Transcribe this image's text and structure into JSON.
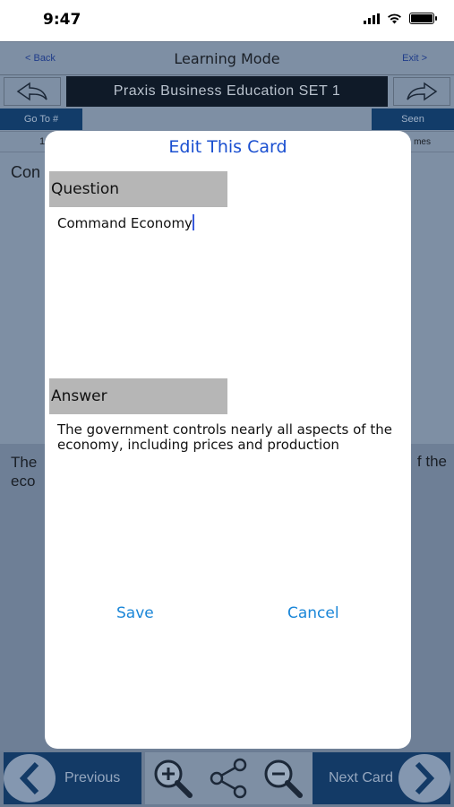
{
  "status": {
    "time": "9:47"
  },
  "nav": {
    "back": "< Back",
    "title": "Learning Mode",
    "exit": "Exit >"
  },
  "set": {
    "title": "Praxis Business Education  SET 1"
  },
  "toolbar": {
    "goto": "Go To #",
    "seen": "Seen"
  },
  "info": {
    "left": "1",
    "right": "mes"
  },
  "background": {
    "question_partial": "Con",
    "answer_partial_left_1": "The",
    "answer_partial_left_2": "eco",
    "answer_partial_right": "f the"
  },
  "modal": {
    "title": "Edit This Card",
    "question_label": "Question",
    "question_value": "Command Economy",
    "answer_label": "Answer",
    "answer_value": "The government controls nearly all aspects of the economy, including prices and production",
    "save": "Save",
    "cancel": "Cancel"
  },
  "bottom": {
    "previous": "Previous",
    "next": "Next Card"
  },
  "colors": {
    "accent": "#1a4fd0",
    "button": "#1a86d8",
    "dark_blue": "#133a66"
  }
}
